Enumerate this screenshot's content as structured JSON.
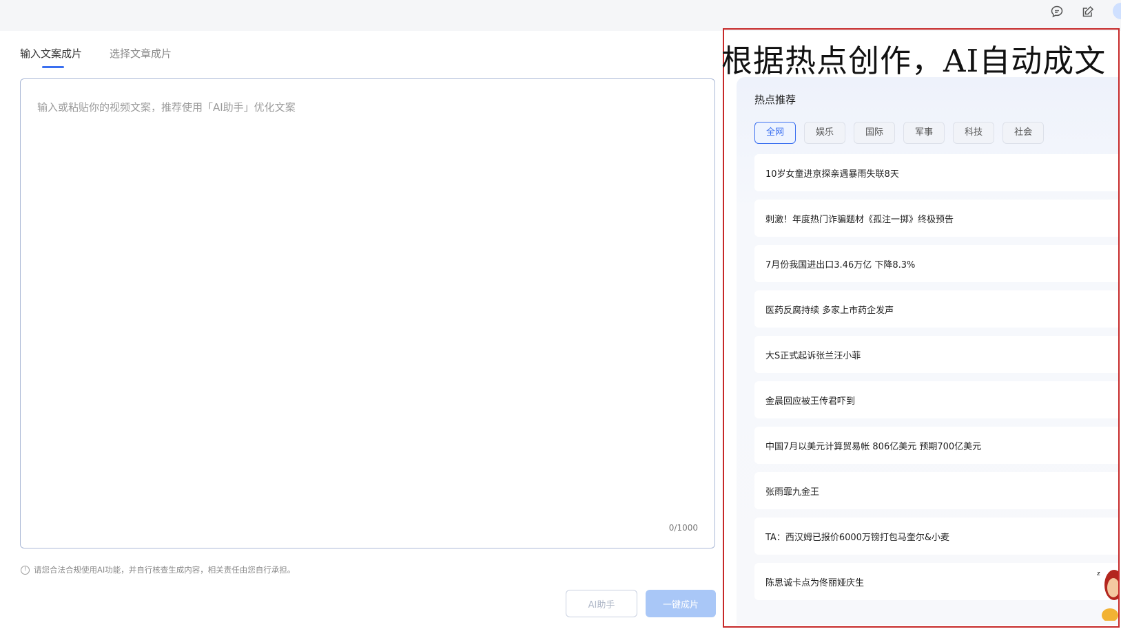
{
  "tabs": [
    {
      "label": "输入文案成片",
      "active": true
    },
    {
      "label": "选择文章成片",
      "active": false
    }
  ],
  "editor": {
    "placeholder": "输入或粘贴你的视频文案，推荐使用「AI助手」优化文案",
    "value": "",
    "counter": "0/1000"
  },
  "notice": {
    "icon": "info-icon",
    "text": "请您合法合规使用AI功能，并自行核查生成内容，相关责任由您自行承担。"
  },
  "buttons": {
    "ai_assistant": "AI助手",
    "one_click": "一键成片"
  },
  "topbar": {
    "icons": [
      "chat-icon",
      "edit-icon"
    ]
  },
  "hot": {
    "banner": "根据热点创作，AI自动成文",
    "title": "热点推荐",
    "categories": [
      {
        "label": "全网",
        "active": true
      },
      {
        "label": "娱乐",
        "active": false
      },
      {
        "label": "国际",
        "active": false
      },
      {
        "label": "军事",
        "active": false
      },
      {
        "label": "科技",
        "active": false
      },
      {
        "label": "社会",
        "active": false
      }
    ],
    "items": [
      "10岁女童进京探亲遇暴雨失联8天",
      "刺激！年度热门诈骗题材《孤注一掷》终极预告",
      "7月份我国进出口3.46万亿 下降8.3%",
      "医药反腐持续 多家上市药企发声",
      "大S正式起诉张兰汪小菲",
      "金晨回应被王传君吓到",
      "中国7月以美元计算贸易帐 806亿美元 预期700亿美元",
      "张雨霏九金王",
      "TA：西汉姆已报价6000万镑打包马奎尔&小麦",
      "陈思诚卡点为佟丽娅庆生"
    ]
  },
  "colors": {
    "accent": "#3a6ff0",
    "highlight_frame": "#c62828",
    "button_primary": "#a9c7f7"
  }
}
